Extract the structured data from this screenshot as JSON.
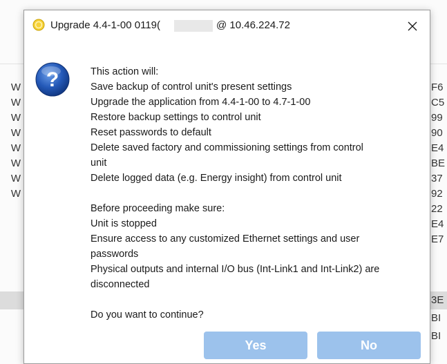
{
  "dialog": {
    "title_prefix": "Upgrade 4.4-1-00 0119(",
    "title_suffix": "@ 10.46.224.72",
    "close_label": "×",
    "message_lines": [
      "This action will:",
      "Save backup of control unit's present settings",
      "Upgrade the application from 4.4-1-00 to 4.7-1-00",
      "Restore backup settings to control unit",
      "Reset passwords to default",
      "Delete saved factory and commissioning settings from control",
      "unit",
      "Delete logged data (e.g. Energy insight) from control unit",
      "",
      "Before proceeding make sure:",
      "Unit is stopped",
      "Ensure access to any customized Ethernet settings and user",
      "passwords",
      "Physical outputs and internal I/O bus (Int-Link1 and Int-Link2) are",
      "disconnected",
      "",
      "Do you want to continue?"
    ],
    "yes_label": "Yes",
    "no_label": "No",
    "button_color": "#9cc2ec",
    "icon": "question-icon",
    "title_icon": "upgrade-icon"
  },
  "background": {
    "left_cells": [
      "W",
      "W",
      "W",
      "W",
      "W",
      "W",
      "W",
      "W"
    ],
    "right_cells": [
      "F6",
      "C5",
      "99",
      "90",
      "E4",
      "BE",
      "37",
      "92",
      "22",
      "E4",
      "E7",
      "3E",
      "BI",
      "BI"
    ]
  }
}
